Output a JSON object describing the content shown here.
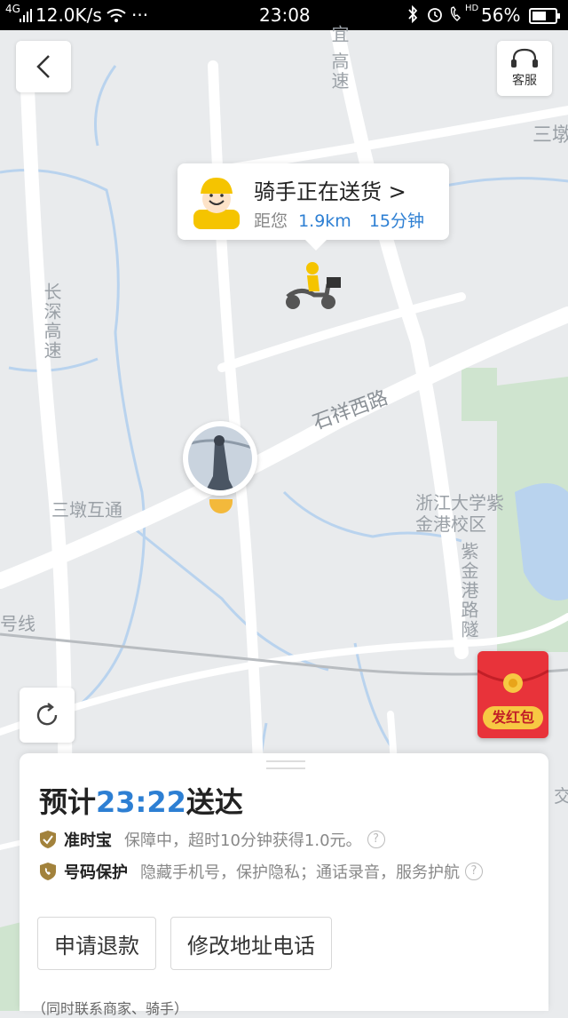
{
  "status_bar": {
    "network": "4G",
    "speed": "12.0K/s",
    "dots": "···",
    "time": "23:08",
    "battery": "56%",
    "hd": "HD"
  },
  "map": {
    "labels": {
      "expressway_top": "宜 高速",
      "changshen": "长深高速",
      "shixiang": "石祥西路",
      "sandun": "三墩互通",
      "zju": "浙江大学紫金港校区",
      "zijingang": "紫金港路隧",
      "line": "号线",
      "san_right": "三墩",
      "jiao": "交"
    },
    "colors": {
      "road": "#ffffff",
      "water": "#b9d3ee",
      "green": "#cfe4cf"
    }
  },
  "back_button": {
    "icon": "chevron-left-icon"
  },
  "customer_service": {
    "label": "客服",
    "icon": "headset-icon"
  },
  "rider_bubble": {
    "status": "骑手正在送货",
    "arrow": ">",
    "distance_prefix": "距您",
    "distance": "1.9km",
    "eta_minutes": "15分钟"
  },
  "refresh_button": {
    "icon": "refresh-icon"
  },
  "red_packet": {
    "label": "发红包",
    "icon": "red-envelope-icon"
  },
  "order_card": {
    "eta_prefix": "预计",
    "eta_time": "23:22",
    "eta_suffix": "送达",
    "guarantees": [
      {
        "title": "准时宝",
        "desc": "保障中，超时10分钟获得1.0元。",
        "help": "?"
      },
      {
        "title": "号码保护",
        "desc": "隐藏手机号，保护隐私；通话录音，服务护航",
        "help": "?"
      }
    ],
    "buttons": {
      "refund": "申请退款",
      "modify": "修改地址电话"
    },
    "footer_note": "（同时联系商家、骑手）"
  },
  "accent_color": "#2d7fd3"
}
